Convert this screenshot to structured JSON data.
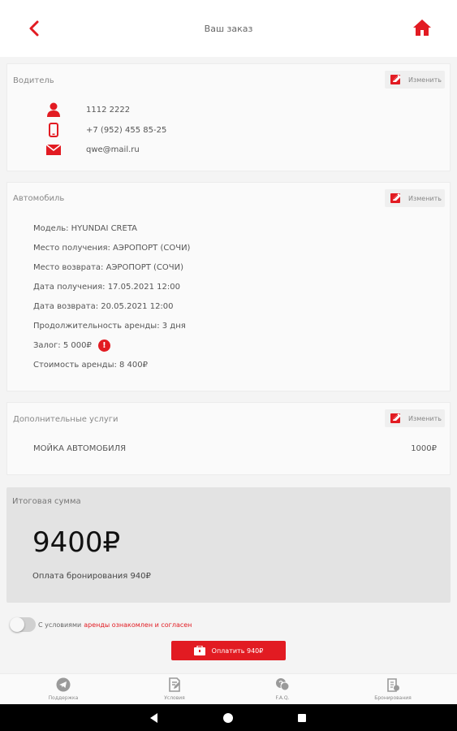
{
  "header": {
    "title": "Ваш заказ",
    "back_icon": "chevron-left-icon",
    "home_icon": "home-icon",
    "accent": "#e21b22"
  },
  "driver": {
    "heading": "Водитель",
    "edit_label": "Изменить",
    "name": "1112 2222",
    "phone": "+7 (952) 455 85-25",
    "email": "qwe@mail.ru"
  },
  "car": {
    "heading": "Автомобиль",
    "edit_label": "Изменить",
    "lines": [
      "Модель: HYUNDAI CRETA",
      "Место получения: АЭРОПОРТ (СОЧИ)",
      "Место возврата: АЭРОПОРТ (СОЧИ)",
      "Дата получения: 17.05.2021 12:00",
      "Дата возврата: 20.05.2021 12:00",
      "Продолжительность аренды: 3 дня",
      "Залог: 5 000₽",
      "Стоимость аренды: 8 400₽"
    ],
    "info_badge": "!"
  },
  "extras": {
    "heading": "Дополнительные услуги",
    "edit_label": "Изменить",
    "item_name": "МОЙКА АВТОМОБИЛЯ",
    "item_price": "1000₽"
  },
  "total": {
    "heading": "Итоговая сумма",
    "amount": "9400₽",
    "booking": "Оплата бронирования 940₽"
  },
  "agreement": {
    "prefix": "С условиями",
    "link": "аренды ознакомлен и согласен",
    "toggle_on": false
  },
  "pay_button": {
    "label": "Оплатить 940₽"
  },
  "bottom_nav": [
    {
      "label": "Поддержка",
      "icon": "telegram-icon"
    },
    {
      "label": "Условия",
      "icon": "document-edit-icon"
    },
    {
      "label": "F.A.Q.",
      "icon": "faq-chat-icon"
    },
    {
      "label": "Бронирования",
      "icon": "bookings-icon"
    }
  ],
  "system_nav": {
    "back": "back-triangle-icon",
    "home": "home-circle-icon",
    "recents": "recents-square-icon"
  }
}
